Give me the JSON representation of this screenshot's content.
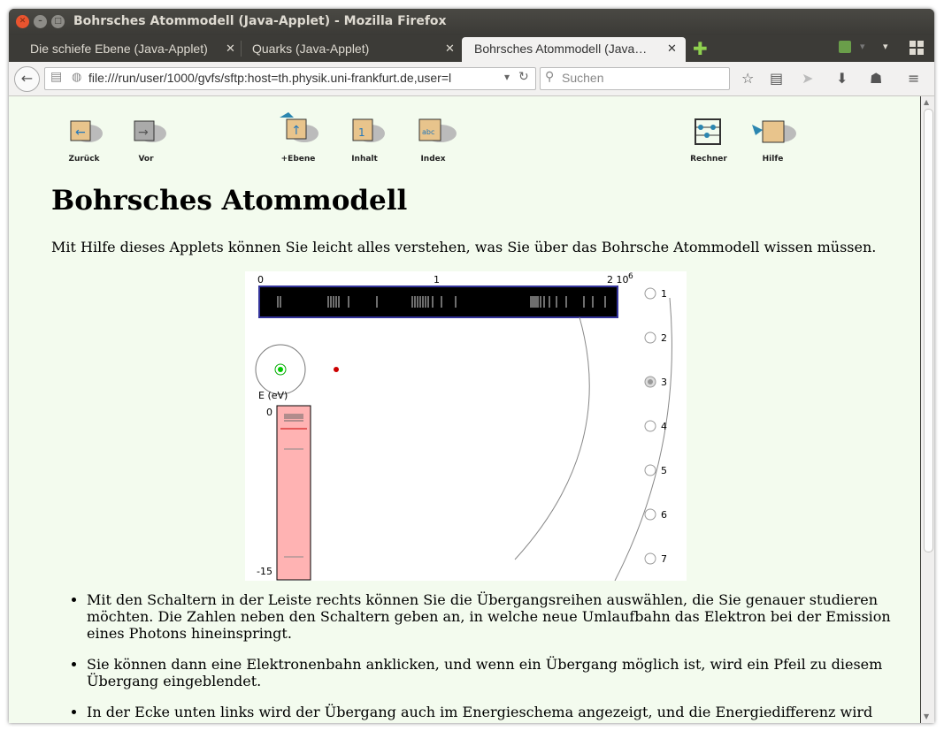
{
  "window": {
    "title": "Bohrsches Atommodell (Java-Applet) - Mozilla Firefox"
  },
  "tabs": [
    {
      "label": "Die schiefe Ebene (Java-Applet)",
      "active": false
    },
    {
      "label": "Quarks (Java-Applet)",
      "active": false
    },
    {
      "label": "Bohrsches Atommodell (Java…",
      "active": true
    }
  ],
  "urlbar": {
    "value": "file:///run/user/1000/gvfs/sftp:host=th.physik.uni-frankfurt.de,user=l"
  },
  "search": {
    "placeholder": "Suchen"
  },
  "sitenav": {
    "back": "Zurück",
    "forward": "Vor",
    "up": "+Ebene",
    "contents": "Inhalt",
    "index": "Index",
    "calculator": "Rechner",
    "help": "Hilfe"
  },
  "page": {
    "heading": "Bohrsches Atommodell",
    "intro": "Mit Hilfe dieses Applets können Sie leicht alles verstehen, was Sie über das Bohrsche Atommodell wissen müssen.",
    "bullets": [
      "Mit den Schaltern in der Leiste rechts können Sie die Übergangsreihen auswählen, die Sie genauer studieren möchten. Die Zahlen neben den Schaltern geben an, in welche neue Umlaufbahn das Elektron bei der Emission eines Photons hineinspringt.",
      "Sie können dann eine Elektronenbahn anklicken, und wenn ein Übergang möglich ist, wird ein Pfeil zu diesem Übergang eingeblendet.",
      "In der Ecke unten links wird der Übergang auch im Energieschema angezeigt, und die Energiedifferenz wird"
    ]
  },
  "applet": {
    "spectrum_labels": [
      "0",
      "1",
      "2 10"
    ],
    "spectrum_exponent": "6",
    "energy_axis_label": "E (eV)",
    "energy_top": "0",
    "energy_bottom": "-15",
    "series_options": [
      "1",
      "2",
      "3",
      "4",
      "5",
      "6",
      "7"
    ],
    "selected_series": "3",
    "colors": {
      "spectrum_bg": "#000000",
      "spectrum_border": "#333399",
      "energy_bar": "#ffb3b3",
      "electron": "#00cc00",
      "nucleus": "#cc0000"
    }
  }
}
